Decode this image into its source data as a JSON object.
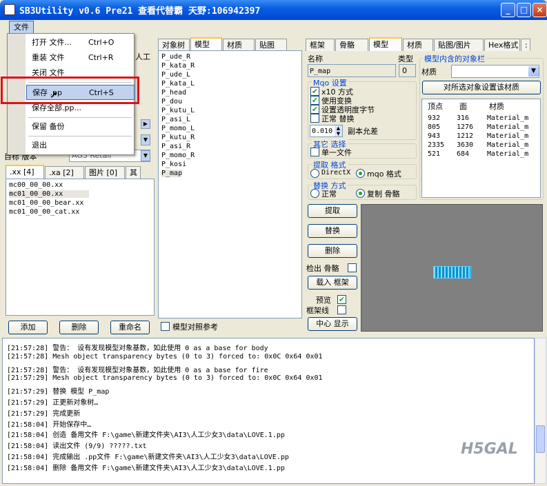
{
  "window": {
    "title": "SB3Utility v0.6 Pre21 查看代替霸 天野:106942397"
  },
  "titlebar_buttons": {
    "minimize": "_",
    "maximize": "□",
    "close": "×"
  },
  "menu": {
    "file": "文件",
    "items": [
      {
        "label": "打开 文件...",
        "shortcut": "Ctrl+O"
      },
      {
        "label": "重装 文件",
        "shortcut": "Ctrl+R"
      },
      {
        "label": "关闭 文件",
        "shortcut": ""
      },
      {
        "label": "保存 .pp",
        "shortcut": "Ctrl+S"
      },
      {
        "label": "保存全部.pp...",
        "shortcut": ""
      },
      {
        "label": "保留 备份",
        "shortcut": ""
      },
      {
        "label": "退出",
        "shortcut": ""
      }
    ]
  },
  "left": {
    "partial_label_right": "人工",
    "version_label": "目标 版本",
    "version_value": "AG3 Retail",
    "tabs": [
      ".xx [4]",
      ".xa [2]",
      "图片 [0]",
      "其"
    ],
    "files": [
      "mc00_00_00.xx",
      "mc01_00_00.xx",
      "mc01_00_00_bear.xx",
      "mc01_00_00_cat.xx"
    ],
    "add_button": "添加",
    "delete_button": "删除",
    "rename_button": "重命名"
  },
  "middle": {
    "tabs": [
      "对象树",
      "模型",
      "材质",
      "贴图"
    ],
    "objects": [
      "P_ude_R",
      "P_kata_R",
      "P_ude_L",
      "P_kata_L",
      "P_head",
      "P_dou",
      "P_kutu_L",
      "P_asi_L",
      "P_momo_L",
      "P_kutu_R",
      "P_asi_R",
      "P_momo_R",
      "P_kosi",
      "P_map"
    ],
    "model_ref_checkbox": "模型对照参考"
  },
  "right": {
    "tabs": [
      "框架",
      "骨骼",
      "模型",
      "材质",
      "贴图/图片",
      "Hex格式"
    ],
    "tab_more": ":",
    "name_label": "名称",
    "name_value": "P_map",
    "type_label": "类型",
    "type_value": "0",
    "mqo_group": "Mqo 设置",
    "mqo_options": [
      {
        "label": "x10 方式",
        "checked": true
      },
      {
        "label": "使用变换",
        "checked": true
      },
      {
        "label": "设置透明度字节",
        "checked": true
      },
      {
        "label": "正常 替换",
        "checked": false
      }
    ],
    "tolerance_value": "0.010",
    "tolerance_label": "副本允差",
    "other_group": "其它 选择",
    "single_file": "单一文件",
    "extract_group": "提取 格式",
    "extract_options": [
      "DirectX",
      "mqo 格式"
    ],
    "extract_selected": "mqo 格式",
    "replace_group": "替换 方式",
    "replace_options": [
      "正常",
      "复制 骨骼"
    ],
    "replace_selected": "复制 骨骼",
    "buttons": {
      "extract": "提取",
      "replace": "替换",
      "delete": "删除",
      "load_frame": "载入 框架",
      "center": "中心 显示"
    },
    "export_bones": "检出 骨骼",
    "preview": "预览",
    "wireframe": "框架线",
    "model_objects_group": "模型内含的对象栏",
    "material_label": "材质",
    "apply_material_button": "对所选对象设置该材质",
    "table": {
      "headers": [
        "顶点",
        "面",
        "材质"
      ],
      "rows": [
        [
          "932",
          "316",
          "Material_m"
        ],
        [
          "805",
          "1276",
          "Material_m"
        ],
        [
          "943",
          "1212",
          "Material_m"
        ],
        [
          "2335",
          "3630",
          "Material_m"
        ],
        [
          "521",
          "684",
          "Material_m"
        ]
      ]
    }
  },
  "log": [
    "[21:57:28] 警告： 设有发现模型对象基数，如此使用 0 as a base for body",
    "[21:57:28] Mesh object transparency bytes (0 to 3) forced to: 0x0C 0x64 0x01",
    "[21:57:28] 警告： 设有发现模型对象基数，如此使用 0 as a base for fire",
    "[21:57:29] Mesh object transparency bytes (0 to 3) forced to: 0x0C 0x64 0x01",
    "[21:57:29] 替换 模型 P_map",
    "[21:57:29] 正更新对象树…",
    "[21:57:29] 完成更新",
    "[21:58:04] 开始保存中…",
    "[21:58:04] 创造 备用文件 F:\\game\\新建文件夹\\AI3\\人工少女3\\data\\LOVE.1.pp",
    "[21:58:04] 读出文件 (9/9) ?????.txt",
    "[21:58:04] 完成输出 .pp文件 F:\\game\\新建文件夹\\AI3\\人工少女3\\data\\LOVE.pp",
    "[21:58:04] 删除 备用文件 F:\\game\\新建文件夹\\AI3\\人工少女3\\data\\LOVE.1.pp"
  ],
  "watermark": "H5GAL"
}
